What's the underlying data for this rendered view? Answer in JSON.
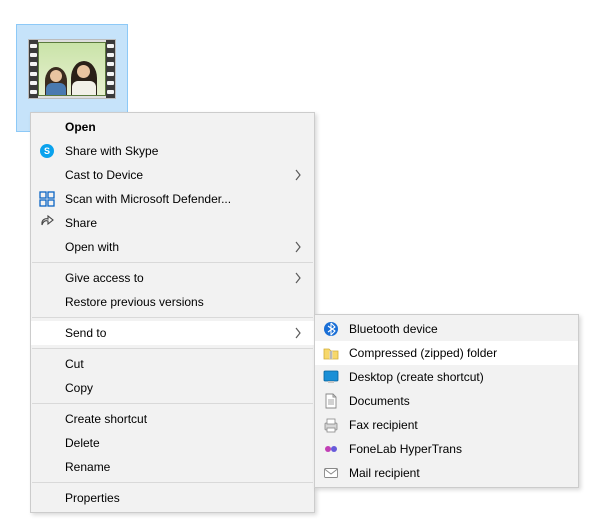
{
  "file_tile": {
    "label": "video file"
  },
  "main_menu": [
    {
      "label": "Open",
      "bold": true
    },
    {
      "label": "Share with Skype",
      "icon": "skype-icon"
    },
    {
      "label": "Cast to Device",
      "submenu": true
    },
    {
      "label": "Scan with Microsoft Defender...",
      "icon": "defender-icon"
    },
    {
      "label": "Share",
      "icon": "share-icon"
    },
    {
      "label": "Open with",
      "submenu": true
    },
    {
      "sep": true
    },
    {
      "label": "Give access to",
      "submenu": true
    },
    {
      "label": "Restore previous versions"
    },
    {
      "sep": true
    },
    {
      "label": "Send to",
      "submenu": true,
      "highlight": true
    },
    {
      "sep": true
    },
    {
      "label": "Cut"
    },
    {
      "label": "Copy"
    },
    {
      "sep": true
    },
    {
      "label": "Create shortcut"
    },
    {
      "label": "Delete"
    },
    {
      "label": "Rename"
    },
    {
      "sep": true
    },
    {
      "label": "Properties"
    }
  ],
  "sub_menu": [
    {
      "label": "Bluetooth device",
      "icon": "bluetooth-icon"
    },
    {
      "label": "Compressed (zipped) folder",
      "icon": "zip-icon",
      "highlight": true
    },
    {
      "label": "Desktop (create shortcut)",
      "icon": "desktop-icon"
    },
    {
      "label": "Documents",
      "icon": "documents-icon"
    },
    {
      "label": "Fax recipient",
      "icon": "fax-icon"
    },
    {
      "label": "FoneLab HyperTrans",
      "icon": "hypertrans-icon"
    },
    {
      "label": "Mail recipient",
      "icon": "mail-icon"
    }
  ]
}
